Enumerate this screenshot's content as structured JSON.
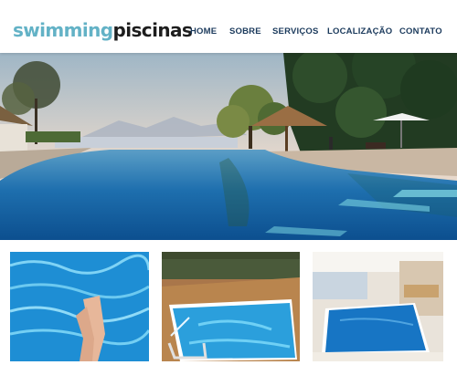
{
  "brand": {
    "part1": "swimming",
    "part2": "piscinas",
    "color_accent": "#63b2c6",
    "color_dark": "#1d1d1d"
  },
  "nav": {
    "items": [
      {
        "label": "HOME"
      },
      {
        "label": "SOBRE"
      },
      {
        "label": "SERVIÇOS"
      },
      {
        "label": "LOCALIZAÇÃO"
      },
      {
        "label": "CONTATO"
      }
    ],
    "color": "#1b3a5c"
  },
  "hero": {
    "image": "resort-infinity-pool-at-sunset"
  },
  "gallery": [
    {
      "image": "legs-in-pool-water"
    },
    {
      "image": "pool-with-wooden-deck-and-ladder"
    },
    {
      "image": "indoor-pool-in-house"
    }
  ]
}
